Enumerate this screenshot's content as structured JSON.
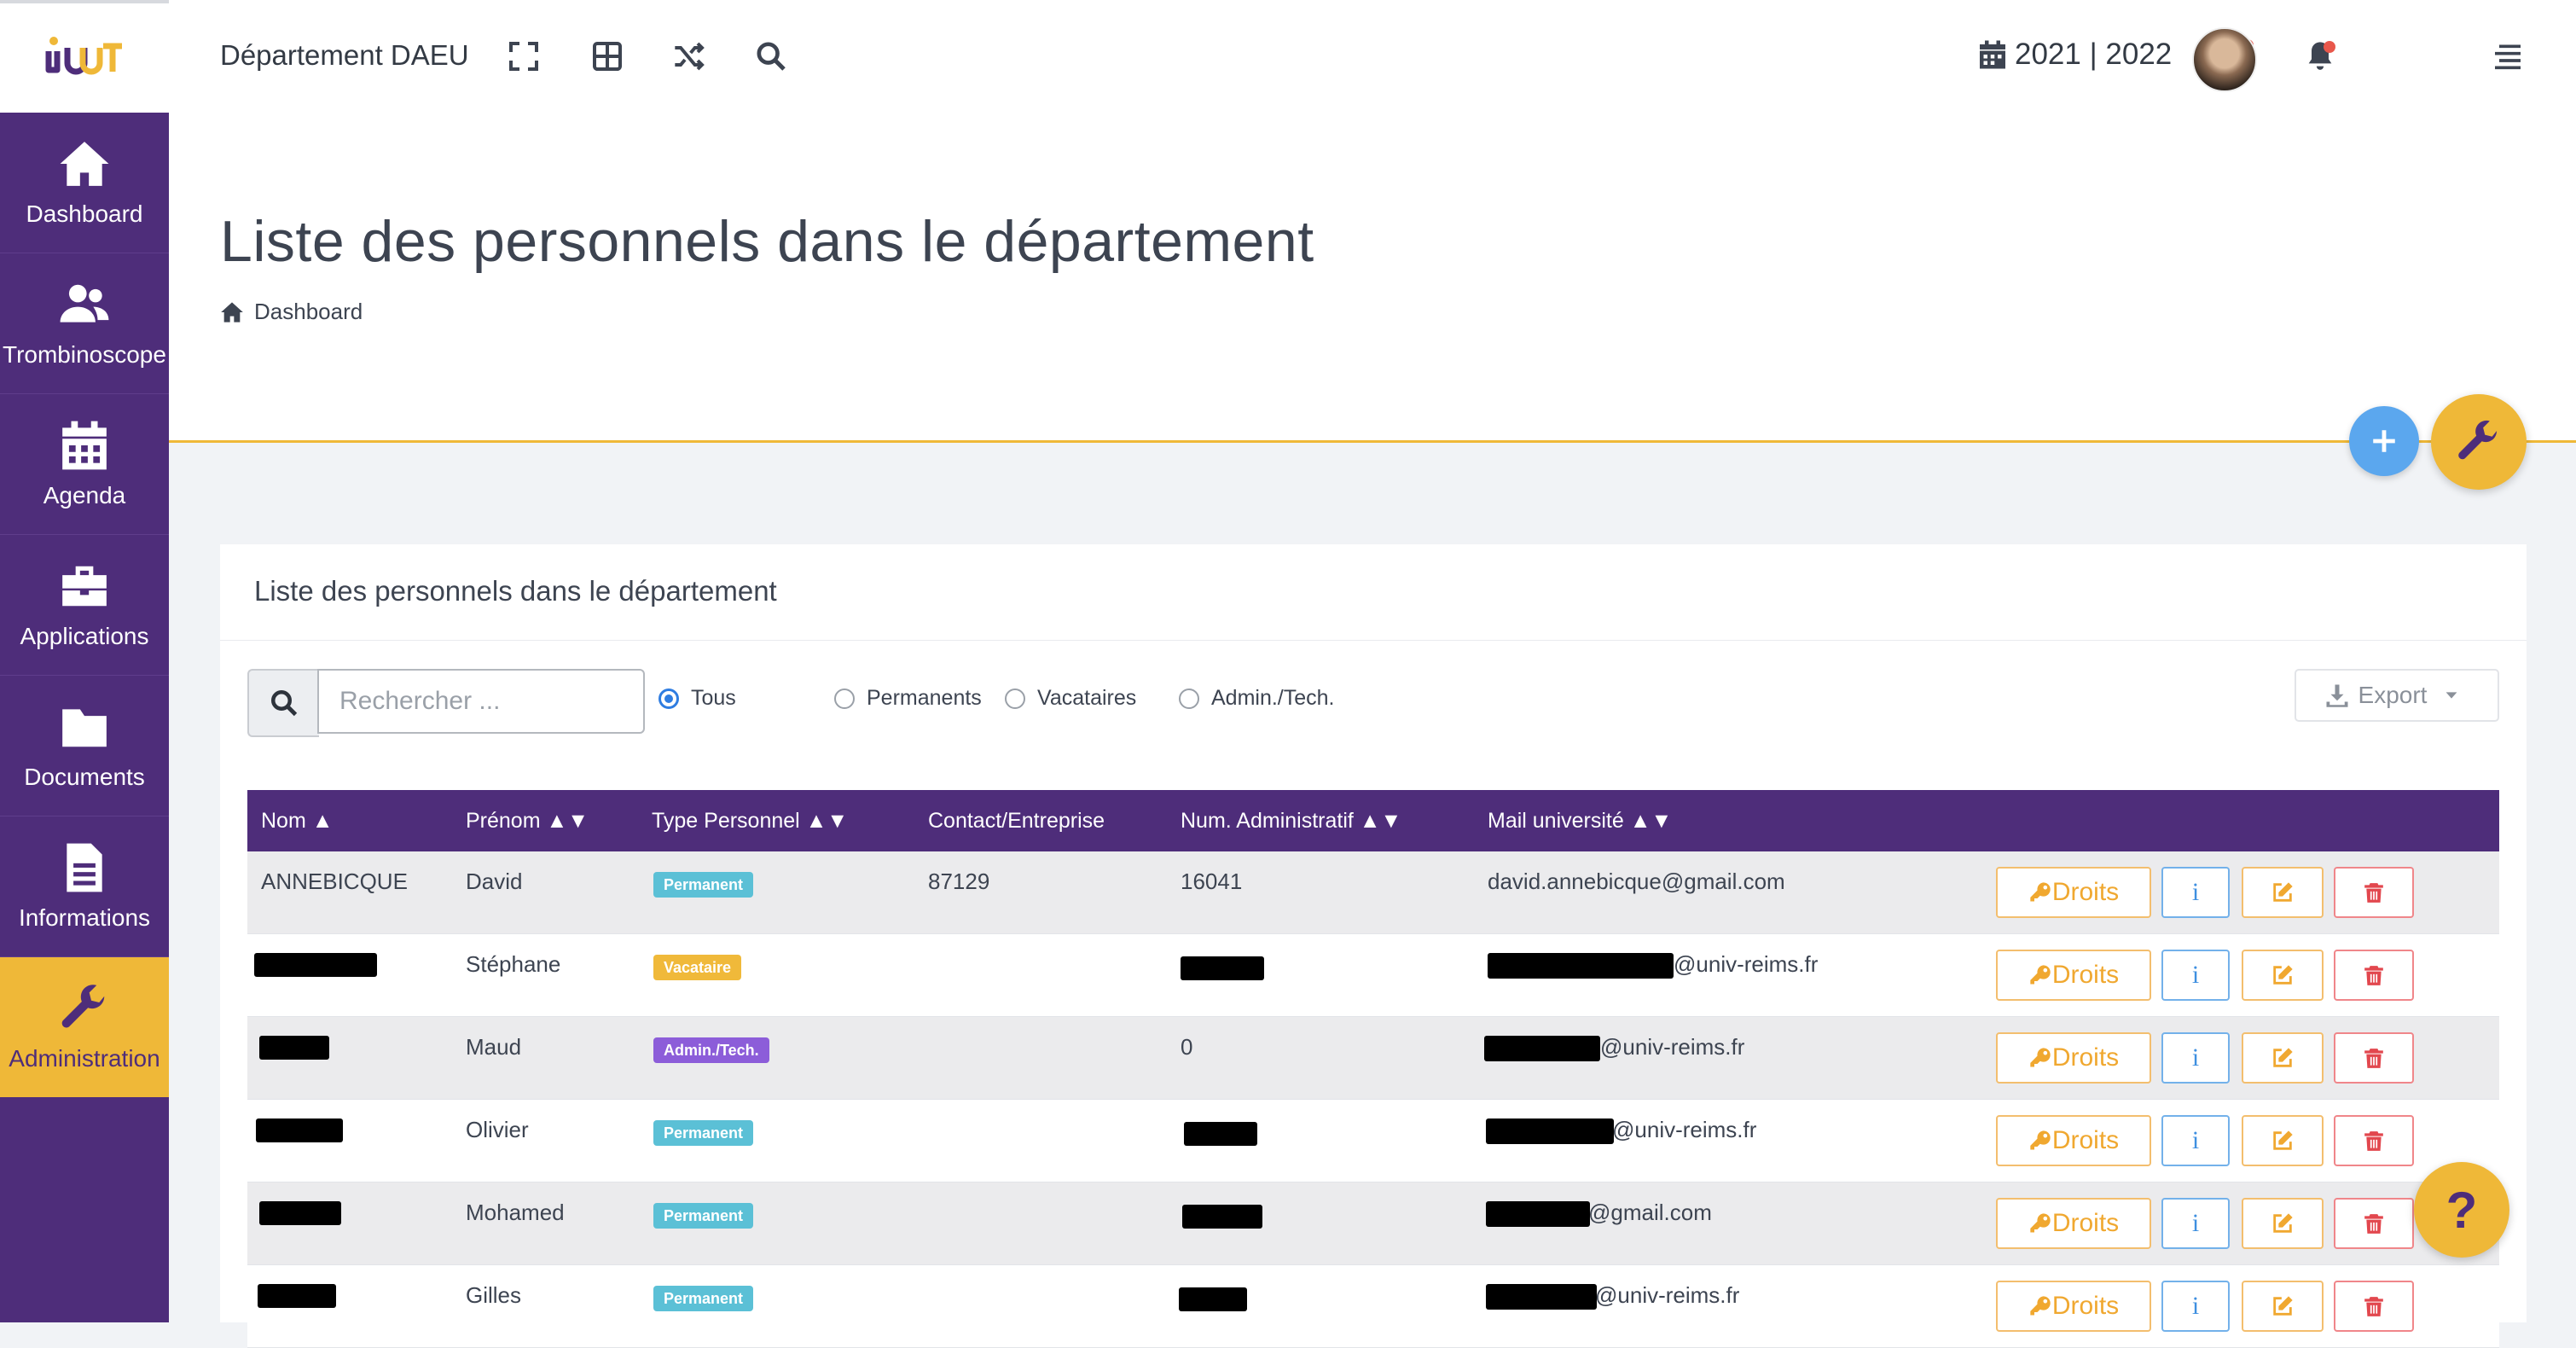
{
  "header": {
    "department": "Département DAEU",
    "year": "2021 | 2022"
  },
  "sidebar": {
    "items": [
      {
        "label": "Dashboard"
      },
      {
        "label": "Trombinoscope"
      },
      {
        "label": "Agenda"
      },
      {
        "label": "Applications"
      },
      {
        "label": "Documents"
      },
      {
        "label": "Informations"
      },
      {
        "label": "Administration"
      }
    ]
  },
  "page": {
    "title": "Liste des personnels dans le département",
    "breadcrumb": "Dashboard"
  },
  "card": {
    "title": "Liste des personnels dans le département",
    "search_placeholder": "Rechercher ...",
    "filters": [
      "Tous",
      "Permanents",
      "Vacataires",
      "Admin./Tech."
    ],
    "selected_filter": "Tous",
    "export_label": "Export"
  },
  "table": {
    "columns": [
      "Nom ▲",
      "Prénom ▲▼",
      "Type Personnel ▲▼",
      "Contact/Entreprise",
      "Num. Administratif ▲▼",
      "Mail université ▲▼"
    ],
    "actions": {
      "droits": "Droits",
      "info": "i"
    },
    "rows": [
      {
        "nom": "ANNEBICQUE",
        "prenom": "David",
        "type": "Permanent",
        "contact": "87129",
        "num": "16041",
        "mail": "david.annebicque@gmail.com"
      },
      {
        "nom": "",
        "prenom": "Stéphane",
        "type": "Vacataire",
        "contact": "",
        "num": "",
        "mail": "@univ-reims.fr"
      },
      {
        "nom": "",
        "prenom": "Maud",
        "type": "Admin./Tech.",
        "contact": "",
        "num": "0",
        "mail": "@univ-reims.fr"
      },
      {
        "nom": "",
        "prenom": "Olivier",
        "type": "Permanent",
        "contact": "",
        "num": "",
        "mail": "@univ-reims.fr"
      },
      {
        "nom": "",
        "prenom": "Mohamed",
        "type": "Permanent",
        "contact": "",
        "num": "",
        "mail": "@gmail.com"
      },
      {
        "nom": "",
        "prenom": "Gilles",
        "type": "Permanent",
        "contact": "",
        "num": "",
        "mail": "@univ-reims.fr"
      }
    ]
  },
  "help_label": "?",
  "colors": {
    "sidebar": "#4e2d7a",
    "accent": "#efb838",
    "primary_blue": "#5ba7ee",
    "danger": "#e2474e"
  }
}
